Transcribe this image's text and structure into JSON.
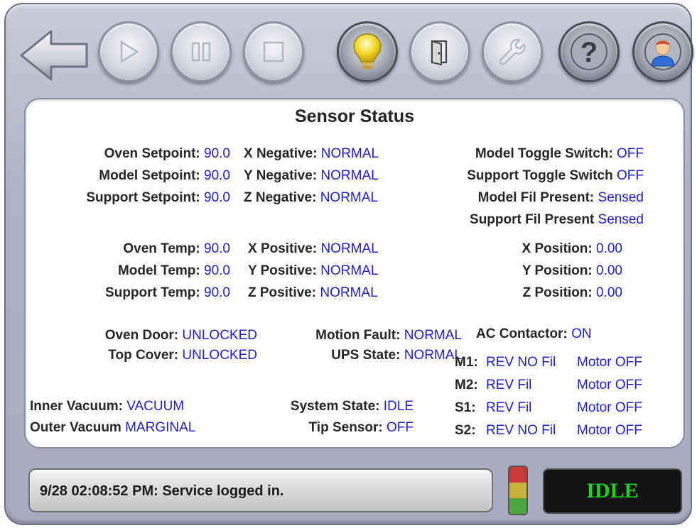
{
  "toolbar": {
    "buttons": [
      {
        "icon": "back-arrow-icon",
        "enabled": true
      },
      {
        "icon": "play-icon",
        "enabled": false
      },
      {
        "icon": "pause-icon",
        "enabled": false
      },
      {
        "icon": "stop-icon",
        "enabled": false
      },
      {
        "icon": "lightbulb-icon",
        "enabled": true
      },
      {
        "icon": "door-icon",
        "enabled": true
      },
      {
        "icon": "wrench-icon",
        "enabled": false
      },
      {
        "icon": "help-icon",
        "enabled": true
      },
      {
        "icon": "user-icon",
        "enabled": true
      }
    ]
  },
  "panel": {
    "title": "Sensor Status",
    "setpoints": [
      {
        "label": "Oven Setpoint:",
        "value": "90.0"
      },
      {
        "label": "Model Setpoint:",
        "value": "90.0"
      },
      {
        "label": "Support Setpoint:",
        "value": "90.0"
      }
    ],
    "negatives": [
      {
        "label": "X Negative:",
        "value": "NORMAL"
      },
      {
        "label": "Y Negative:",
        "value": "NORMAL"
      },
      {
        "label": "Z Negative:",
        "value": "NORMAL"
      }
    ],
    "toggles": [
      {
        "label": "Model Toggle Switch:",
        "value": "OFF"
      },
      {
        "label": "Support Toggle Switch",
        "value": "OFF"
      },
      {
        "label": "Model Fil Present:",
        "value": "Sensed"
      },
      {
        "label": "Support Fil Present",
        "value": "Sensed"
      }
    ],
    "temps": [
      {
        "label": "Oven Temp:",
        "value": "90.0"
      },
      {
        "label": "Model Temp:",
        "value": "90.0"
      },
      {
        "label": "Support Temp:",
        "value": "90.0"
      }
    ],
    "positives": [
      {
        "label": "X Positive:",
        "value": "NORMAL"
      },
      {
        "label": "Y Positive:",
        "value": "NORMAL"
      },
      {
        "label": "Z Positive:",
        "value": "NORMAL"
      }
    ],
    "positions": [
      {
        "label": "X Position:",
        "value": "0.00"
      },
      {
        "label": "Y Position:",
        "value": "0.00"
      },
      {
        "label": "Z Position:",
        "value": "0.00"
      }
    ],
    "locks": [
      {
        "label": "Oven Door:",
        "value": "UNLOCKED"
      },
      {
        "label": "Top Cover:",
        "value": "UNLOCKED"
      }
    ],
    "faults": [
      {
        "label": "Motion Fault:",
        "value": "NORMAL"
      },
      {
        "label": "UPS State:",
        "value": "NORMAL"
      }
    ],
    "ac_contactor": {
      "label": "AC Contactor:",
      "value": "ON"
    },
    "motors": [
      {
        "label": "M1:",
        "fil": "REV NO Fil",
        "motor": "Motor OFF"
      },
      {
        "label": "M2:",
        "fil": "REV Fil",
        "motor": "Motor OFF"
      },
      {
        "label": "S1:",
        "fil": "REV Fil",
        "motor": "Motor OFF"
      },
      {
        "label": "S2:",
        "fil": "REV NO Fil",
        "motor": "Motor OFF"
      }
    ],
    "vacuum": [
      {
        "label": "Inner Vacuum:",
        "value": "VACUUM"
      },
      {
        "label": "Outer Vacuum",
        "value": "MARGINAL"
      }
    ],
    "system": [
      {
        "label": "System State:",
        "value": "IDLE"
      },
      {
        "label": "Tip Sensor:",
        "value": "OFF"
      }
    ]
  },
  "status_bar": {
    "message": "9/28 02:08:52 PM: Service logged in."
  },
  "stack_light": {
    "colors": [
      "#c83a3a",
      "#c9b13a",
      "#4fa83f"
    ]
  },
  "state_display": {
    "text": "IDLE",
    "color": "#1fd01f"
  },
  "colors": {
    "value_text": "#2020c8",
    "label_text": "#262626"
  }
}
